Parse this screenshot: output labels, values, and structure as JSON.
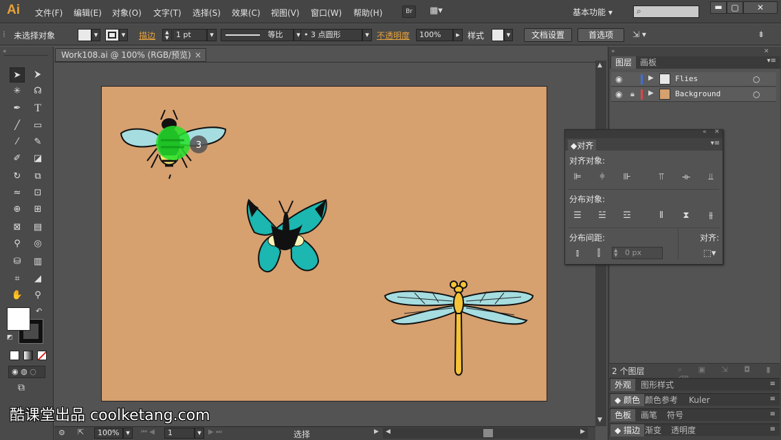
{
  "app": {
    "logo": "Ai",
    "workspace": "基本功能",
    "bridge": "Br"
  },
  "menu": [
    "文件(F)",
    "编辑(E)",
    "对象(O)",
    "文字(T)",
    "选择(S)",
    "效果(C)",
    "视图(V)",
    "窗口(W)",
    "帮助(H)"
  ],
  "control": {
    "selection": "未选择对象",
    "stroke_label": "描边",
    "stroke_weight": "1 pt",
    "profile": "等比",
    "brush": "3 点圆形",
    "opacity_label": "不透明度",
    "opacity": "100%",
    "style_label": "样式",
    "doc_setup": "文档设置",
    "preferences": "首选项"
  },
  "document": {
    "tab": "Work108.ai @ 100% (RGB/预览)",
    "zoom": "100%",
    "page": "1",
    "status": "选择"
  },
  "cursor_badge": "3",
  "layers_panel": {
    "tabs": [
      "图层",
      "画板"
    ],
    "layers": [
      {
        "name": "Flies",
        "color": "#3c6fd8",
        "locked": false
      },
      {
        "name": "Background",
        "color": "#e24444",
        "locked": true
      }
    ],
    "count": "2 个图层"
  },
  "align_panel": {
    "title": "对齐",
    "align_objects": "对齐对象:",
    "distribute_objects": "分布对象:",
    "distribute_spacing": "分布间距:",
    "align_to": "对齐:",
    "spacing_value": "0 px"
  },
  "collapsed_panels": [
    [
      "外观",
      "图形样式"
    ],
    [
      "颜色",
      "颜色参考",
      "Kuler"
    ],
    [
      "色板",
      "画笔",
      "符号"
    ],
    [
      "描边",
      "渐变",
      "透明度"
    ]
  ],
  "watermark": "酷课堂出品 coolketang.com",
  "colors": {
    "artboard": "#d6a06f",
    "accent": "#e8a33a"
  }
}
